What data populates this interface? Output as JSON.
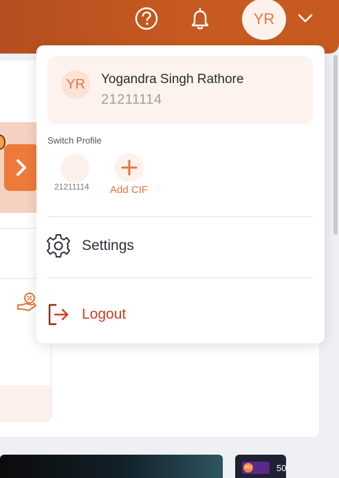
{
  "header": {
    "help_icon": "question-circle-icon",
    "notifications_icon": "bell-icon",
    "avatar_initials": "YR",
    "dropdown_icon": "chevron-down-icon"
  },
  "profile_menu": {
    "user": {
      "initials": "YR",
      "name": "Yogandra Singh Rathore",
      "cif": "21211114"
    },
    "switch_profile": {
      "label": "Switch Profile",
      "profiles": [
        {
          "cif": "21211114"
        }
      ],
      "add_label": "Add CIF"
    },
    "items": [
      {
        "label": "Settings",
        "icon": "gear-icon"
      },
      {
        "label": "Logout",
        "icon": "logout-icon"
      }
    ]
  },
  "background": {
    "tile_text": "50",
    "tile_logo": "AU"
  },
  "colors": {
    "header": "#c75a20",
    "accent": "#e8733a",
    "logout": "#cf3f22"
  }
}
